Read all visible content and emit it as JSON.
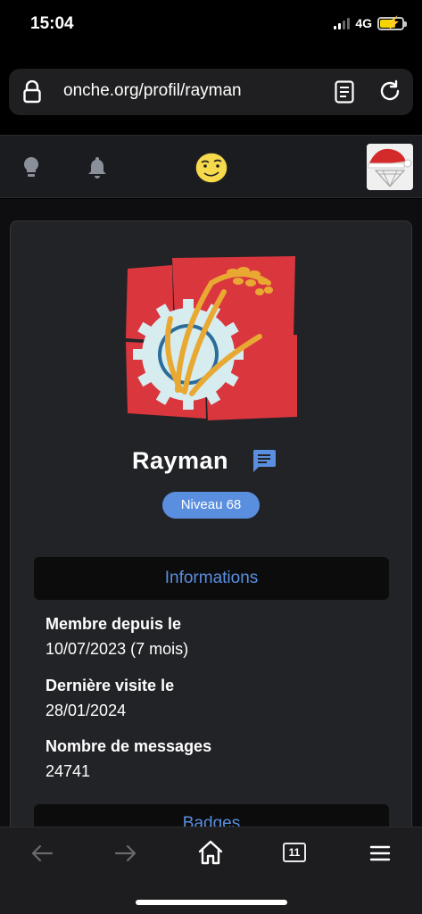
{
  "status": {
    "time": "15:04",
    "network": "4G"
  },
  "browser": {
    "url": "onche.org/profil/rayman",
    "tabs_count": "11"
  },
  "nav": {
    "icons": [
      "bulb-icon",
      "bell-icon",
      "smiley-icon",
      "user-avatar"
    ]
  },
  "profile": {
    "username": "Rayman",
    "level": "Niveau 68"
  },
  "info": {
    "header": "Informations",
    "member_since_label": "Membre depuis le",
    "member_since_value": "10/07/2023 (7 mois)",
    "last_visit_label": "Dernière visite le",
    "last_visit_value": "28/01/2024",
    "messages_label": "Nombre de messages",
    "messages_value": "24741"
  },
  "badges": {
    "header": "Badges"
  },
  "colors": {
    "accent": "#5a8fe0",
    "card_bg": "#222327",
    "flag_red": "#d9363e",
    "gear": "#d6ecef",
    "wheat": "#e8a832"
  }
}
